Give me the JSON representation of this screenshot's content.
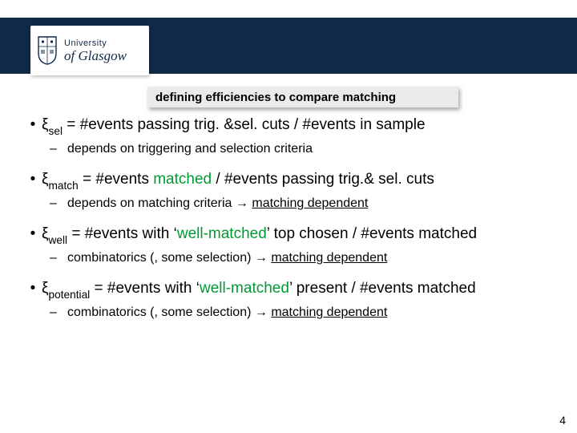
{
  "logo": {
    "line1": "University",
    "line2": "of Glasgow"
  },
  "title": "defining efficiencies to compare matching",
  "bullets": [
    {
      "symbol": "ξ",
      "sub": "sel",
      "text": " = #events passing trig. &sel. cuts / #events in sample",
      "note_pre": "depends on triggering and selection criteria",
      "note_arrow": "",
      "note_post": ""
    },
    {
      "symbol": "ξ",
      "sub": "match",
      "text_pre": " = #events ",
      "text_green": "matched",
      "text_post": " / #events passing trig.& sel. cuts",
      "note_pre": "depends on matching criteria ",
      "note_arrow": "→ ",
      "note_post": "matching dependent"
    },
    {
      "symbol": "ξ",
      "sub": "well",
      "text_pre": " = #events with ‘",
      "text_green": "well-matched",
      "text_post": "’ top chosen / #events matched",
      "note_pre": "combinatorics (, some selection) ",
      "note_arrow": "→ ",
      "note_post": "matching dependent"
    },
    {
      "symbol": "ξ",
      "sub": "potential",
      "text_pre": " = #events with ‘",
      "text_green": "well-matched",
      "text_post": "’ present / #events matched",
      "note_pre": "combinatorics (, some selection) ",
      "note_arrow": "→ ",
      "note_post": "matching dependent"
    }
  ],
  "slide_number": "4"
}
